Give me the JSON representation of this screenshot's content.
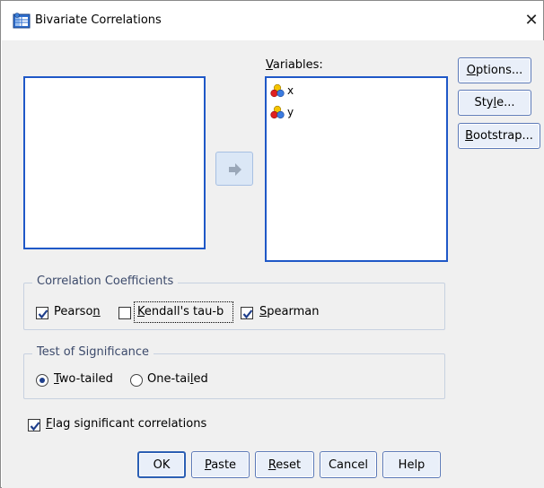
{
  "window": {
    "title": "Bivariate Correlations",
    "close_glyph": "✕"
  },
  "source_list": {
    "items": []
  },
  "variables": {
    "label_pre": "",
    "label_key": "V",
    "label_post": "ariables:",
    "items": [
      {
        "name": "x"
      },
      {
        "name": "y"
      }
    ]
  },
  "side_buttons": {
    "options": {
      "key": "O",
      "rest": "ptions..."
    },
    "style": {
      "pre": "Sty",
      "key": "l",
      "post": "e..."
    },
    "bootstrap": {
      "key": "B",
      "rest": "ootstrap..."
    }
  },
  "correlation": {
    "title": "Correlation Coefficients",
    "pearson": {
      "pre": "Pearso",
      "key": "n",
      "post": "",
      "checked": true
    },
    "kendall": {
      "key": "K",
      "rest": "endall's tau-b",
      "checked": false
    },
    "spearman": {
      "key": "S",
      "rest": "pearman",
      "checked": true
    }
  },
  "significance": {
    "title": "Test of Significance",
    "two_tailed": {
      "key": "T",
      "rest": "wo-tailed",
      "selected": true
    },
    "one_tailed": {
      "pre": "One-tai",
      "key": "l",
      "post": "ed",
      "selected": false
    }
  },
  "flag": {
    "key": "F",
    "rest": "lag significant correlations",
    "checked": true
  },
  "bottom_buttons": {
    "ok": "OK",
    "paste": {
      "key": "P",
      "rest": "aste"
    },
    "reset": {
      "key": "R",
      "rest": "eset"
    },
    "cancel": "Cancel",
    "help": "Help"
  },
  "colors": {
    "accent": "#1f58c7",
    "check": "#1f3f8c"
  }
}
